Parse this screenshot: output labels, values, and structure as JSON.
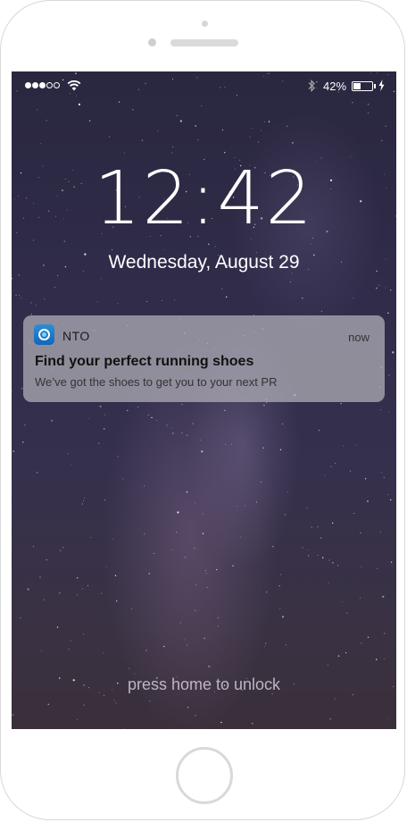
{
  "status_bar": {
    "signal_bars_filled": 3,
    "signal_bars_total": 5,
    "wifi_icon": "wifi-icon",
    "bluetooth_icon": "bluetooth-icon",
    "battery_percent_label": "42%",
    "battery_level": 0.42,
    "charging_icon": "bolt-icon"
  },
  "lock_screen": {
    "time": "12:42",
    "date": "Wednesday, August 29",
    "unlock_hint": "press home to unlock"
  },
  "notification": {
    "app_icon": "nto-app-icon",
    "app_name": "NTO",
    "time": "now",
    "title": "Find your perfect running shoes",
    "body": "We’ve got the shoes to get you to your next PR"
  },
  "colors": {
    "notification_bg": "#aaa8b2",
    "app_icon_blue": "#1e7bcc"
  }
}
